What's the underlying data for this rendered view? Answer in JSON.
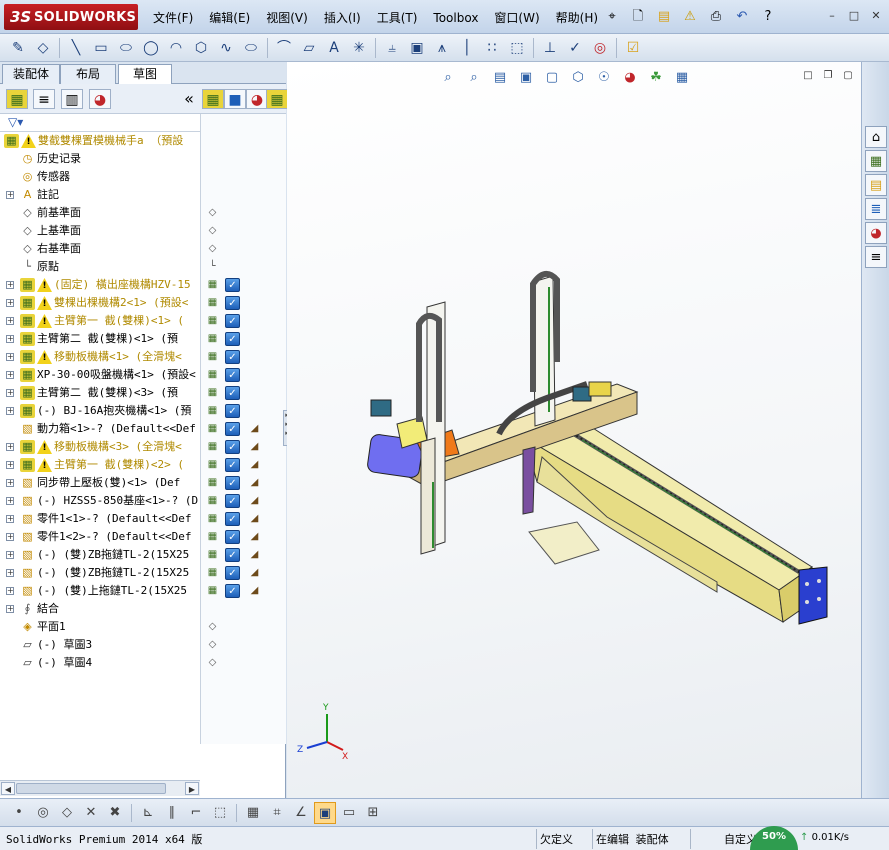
{
  "app": {
    "logo_ds": "3S",
    "logo_text": "SOLIDWORKS"
  },
  "menu": [
    "文件(F)",
    "编辑(E)",
    "视图(V)",
    "插入(I)",
    "工具(T)",
    "Toolbox",
    "窗口(W)",
    "帮助(H)"
  ],
  "std_toolbar_icons": [
    "pin-icon",
    "new-document-icon",
    "open-icon",
    "rebuild-warning-icon",
    "print-icon",
    "undo-icon",
    "help-icon"
  ],
  "window_buttons": [
    "minimize",
    "restore",
    "close"
  ],
  "tabs": [
    "装配体",
    "布局",
    "草图"
  ],
  "active_tab": "草图",
  "feature_tree": [
    {
      "label": "雙截雙棵置模機械手a （預設",
      "icon": "assembly",
      "warn": true,
      "top": true
    },
    {
      "label": "历史记录",
      "icon": "history"
    },
    {
      "label": "传感器",
      "icon": "sensor"
    },
    {
      "label": "註記",
      "icon": "annotation",
      "expand": true
    },
    {
      "label": "前基準面",
      "icon": "plane"
    },
    {
      "label": "上基準面",
      "icon": "plane"
    },
    {
      "label": "右基準面",
      "icon": "plane"
    },
    {
      "label": "原點",
      "icon": "origin"
    },
    {
      "label": "(固定) 橫出座機構HZV-15",
      "icon": "asm",
      "warn": true,
      "expand": true
    },
    {
      "label": "雙棵出棵機構2<1> (預設<",
      "icon": "asm",
      "warn": true,
      "expand": true
    },
    {
      "label": "主臂第一 截(雙棵)<1> (",
      "icon": "asm",
      "warn": true,
      "expand": true
    },
    {
      "label": "主臂第二 截(雙棵)<1> (預",
      "icon": "asm",
      "expand": true
    },
    {
      "label": "移動板機構<1> (全滑塊<",
      "icon": "asm",
      "warn": true,
      "expand": true
    },
    {
      "label": "XP-30-00吸盤機構<1> (預設<",
      "icon": "asm",
      "expand": true
    },
    {
      "label": "主臂第二 截(雙棵)<3> (預",
      "icon": "asm",
      "expand": true
    },
    {
      "label": "(-) BJ-16A抱夾機構<1> (預",
      "icon": "asm",
      "expand": true
    },
    {
      "label": "動力箱<1>-? (Default<<Def",
      "icon": "part"
    },
    {
      "label": "移動板機構<3> (全滑塊<",
      "icon": "asm",
      "warn": true,
      "expand": true
    },
    {
      "label": "主臂第一 截(雙棵)<2> (",
      "icon": "asm",
      "warn": true,
      "expand": true
    },
    {
      "label": "同步帶上壓板(雙)<1> (Def",
      "icon": "part",
      "expand": true
    },
    {
      "label": "(-) HZSS5-850基座<1>-? (D",
      "icon": "part",
      "expand": true
    },
    {
      "label": "零件1<1>-? (Default<<Def",
      "icon": "part",
      "expand": true
    },
    {
      "label": "零件1<2>-? (Default<<Def",
      "icon": "part",
      "expand": true
    },
    {
      "label": "(-) (雙)ZB拖鏈TL-2(15X25",
      "icon": "part",
      "expand": true
    },
    {
      "label": "(-) (雙)ZB拖鏈TL-2(15X25",
      "icon": "part",
      "expand": true
    },
    {
      "label": "(-) (雙)上拖鏈TL-2(15X25",
      "icon": "part",
      "expand": true
    },
    {
      "label": "結合",
      "icon": "mates",
      "expand": true
    },
    {
      "label": "平面1",
      "icon": "plane-yellow"
    },
    {
      "label": "(-) 草圖3",
      "icon": "sketch"
    },
    {
      "label": "(-) 草圖4",
      "icon": "sketch"
    }
  ],
  "triad": {
    "x": "X",
    "y": "Y",
    "z": "Z"
  },
  "status": {
    "product": "SolidWorks Premium 2014 x64 版",
    "definition": "欠定义",
    "mode": "在编辑 装配体",
    "units": "自定义",
    "perf": "50%",
    "net": "0.01K/s"
  }
}
